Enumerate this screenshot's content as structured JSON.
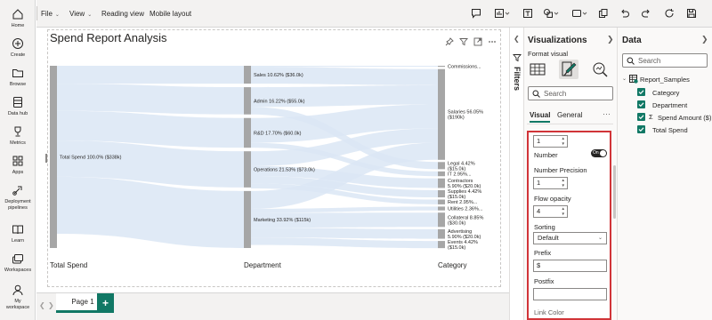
{
  "nav": {
    "items": [
      {
        "key": "home",
        "icon": "home-icon",
        "label": "Home",
        "label2": ""
      },
      {
        "key": "create",
        "icon": "create-icon",
        "label": "Create",
        "label2": ""
      },
      {
        "key": "browse",
        "icon": "browse-icon",
        "label": "Browse",
        "label2": ""
      },
      {
        "key": "datahub",
        "icon": "data-hub-icon",
        "label": "Data hub",
        "label2": ""
      },
      {
        "key": "metrics",
        "icon": "metrics-icon",
        "label": "Metrics",
        "label2": ""
      },
      {
        "key": "apps",
        "icon": "apps-icon",
        "label": "Apps",
        "label2": ""
      },
      {
        "key": "deployment",
        "icon": "deployment-pipelines-icon",
        "label": "Deployment",
        "label2": "pipelines"
      },
      {
        "key": "learn",
        "icon": "learn-icon",
        "label": "Learn",
        "label2": ""
      },
      {
        "key": "workspaces",
        "icon": "workspaces-icon",
        "label": "Workspaces",
        "label2": ""
      },
      {
        "key": "myworkspace",
        "icon": "my-workspace-icon",
        "label": "My",
        "label2": "workspace"
      }
    ]
  },
  "menubar": {
    "file": "File",
    "view": "View",
    "reading_view": "Reading view",
    "mobile_layout": "Mobile layout"
  },
  "visual": {
    "title": "Spend Report Analysis"
  },
  "chart_data": {
    "type": "sankey",
    "title": "Spend Report Analysis",
    "stage_labels": [
      "Total Spend",
      "Department",
      "Category"
    ],
    "source": {
      "name": "Total Spend",
      "label": "Total Spend 100.0% ($338k)",
      "value": 338
    },
    "departments": [
      {
        "name": "Sales",
        "label": "Sales 10.62% ($36.0k)",
        "value": 36.0
      },
      {
        "name": "Admin",
        "label": "Admin 16.22% ($55.0k)",
        "value": 55.0
      },
      {
        "name": "R&D",
        "label": "R&D 17.70% ($60.0k)",
        "value": 60.0
      },
      {
        "name": "Operations",
        "label": "Operations 21.53% ($73.0k)",
        "value": 73.0
      },
      {
        "name": "Marketing",
        "label": "Marketing 33.92% ($115k)",
        "value": 115
      }
    ],
    "categories": [
      {
        "name": "Commissions",
        "line1": "Commissions...",
        "line2": "",
        "value": 2
      },
      {
        "name": "Salaries",
        "line1": "Salaries 56.05%",
        "line2": "($190k)",
        "value": 190
      },
      {
        "name": "Legal",
        "line1": "Legal 4.42%",
        "line2": "($15.0k)",
        "value": 15
      },
      {
        "name": "IT",
        "line1": "IT 2.95%...",
        "line2": "",
        "value": 10
      },
      {
        "name": "Contractors",
        "line1": "Contractors",
        "line2": "5.90% ($20.0k)",
        "value": 20
      },
      {
        "name": "Supplies",
        "line1": "Supplies 4.42%",
        "line2": "($15.0k)",
        "value": 15
      },
      {
        "name": "Rent",
        "line1": "Rent 2.95%...",
        "line2": "",
        "value": 10
      },
      {
        "name": "Utilities",
        "line1": "Utilities 2.36%...",
        "line2": "",
        "value": 8
      },
      {
        "name": "Collateral",
        "line1": "Collateral 8.85%",
        "line2": "($30.0k)",
        "value": 30
      },
      {
        "name": "Advertising",
        "line1": "Advertising",
        "line2": "5.90% ($20.0k)",
        "value": 20
      },
      {
        "name": "Events",
        "line1": "Events 4.42%",
        "line2": "($15.0k)",
        "value": 15
      }
    ]
  },
  "filters": {
    "label": "Filters"
  },
  "viz_pane": {
    "title": "Visualizations",
    "format_label": "Format visual",
    "search_placeholder": "Search",
    "tab_visual": "Visual",
    "tab_general": "General",
    "more": "···",
    "spin_top": "1",
    "number_label": "Number",
    "toggle_text": "On",
    "precision_label": "Number Precision",
    "precision_value": "1",
    "opacity_label": "Flow opacity",
    "opacity_value": "4",
    "sorting_label": "Sorting",
    "sorting_value": "Default",
    "prefix_label": "Prefix",
    "prefix_value": "$",
    "postfix_label": "Postfix",
    "postfix_value": "",
    "link_color_label": "Link Color"
  },
  "data_pane": {
    "title": "Data",
    "search_placeholder": "Search",
    "table_name": "Report_Samples",
    "fields": [
      {
        "name": "Category",
        "sigma": false
      },
      {
        "name": "Department",
        "sigma": false
      },
      {
        "name": "Spend Amount ($)",
        "sigma": true
      },
      {
        "name": "Total Spend",
        "sigma": false
      }
    ]
  },
  "pagebar": {
    "page_label": "Page 1",
    "add_label": "+"
  },
  "colors": {
    "accent": "#117865",
    "highlight_border": "#d13438",
    "link": "#dbe6f4",
    "node": "#a6a6a6"
  }
}
